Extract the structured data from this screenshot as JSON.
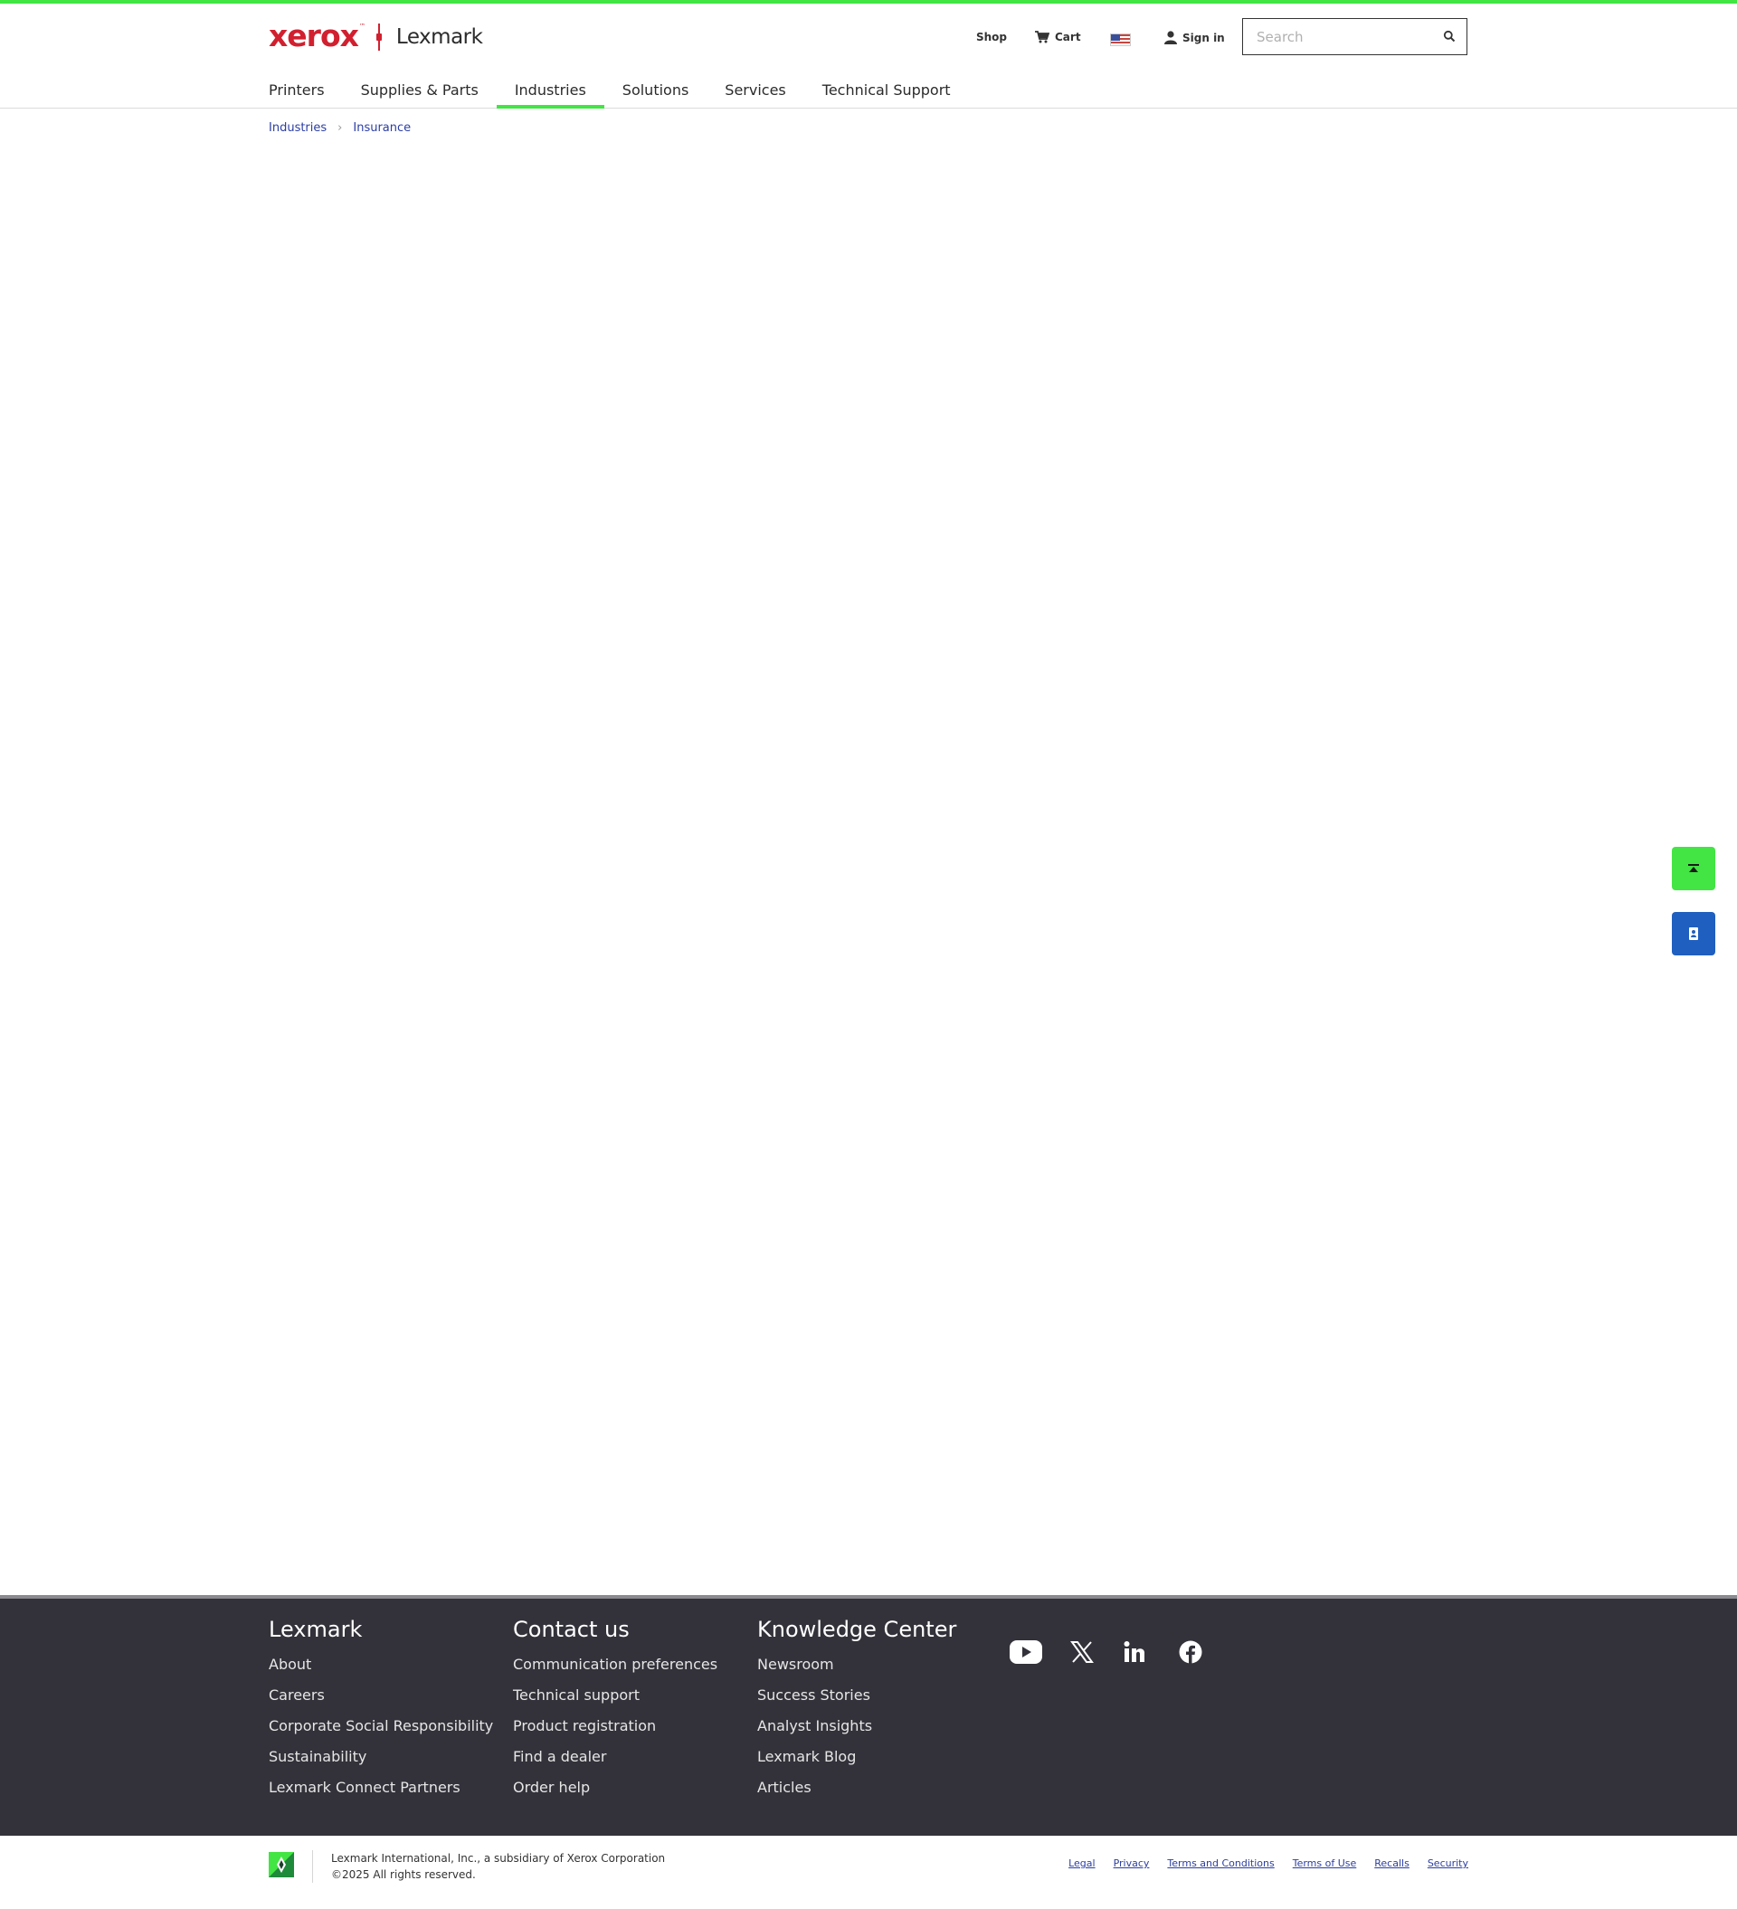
{
  "brand": {
    "primary_logo": "xerox",
    "secondary_logo": "Lexmark",
    "accent_green": "#42e543",
    "xerox_red": "#d1202f",
    "contact_blue": "#1f5fbf"
  },
  "utility": {
    "shop": "Shop",
    "cart": "Cart",
    "country_flag_icon": "us-flag-icon",
    "sign_in": "Sign in"
  },
  "search": {
    "placeholder": "Search",
    "value": ""
  },
  "nav": {
    "items": [
      "Printers",
      "Supplies & Parts",
      "Industries",
      "Solutions",
      "Services",
      "Technical Support"
    ],
    "active": "Industries"
  },
  "breadcrumb": [
    "Industries",
    "Insurance"
  ],
  "side_buttons": {
    "back_to_top_icon": "back-to-top-icon",
    "contact_icon": "contact-card-icon"
  },
  "footer": {
    "columns": [
      {
        "heading": "Lexmark",
        "links": [
          "About",
          "Careers",
          "Corporate Social Responsibility",
          "Sustainability",
          "Lexmark Connect Partners"
        ]
      },
      {
        "heading": "Contact us",
        "links": [
          "Communication preferences",
          "Technical support",
          "Product registration",
          "Find a dealer",
          "Order help"
        ]
      },
      {
        "heading": "Knowledge Center",
        "links": [
          "Newsroom",
          "Success Stories",
          "Analyst Insights",
          "Lexmark Blog",
          "Articles"
        ]
      }
    ],
    "social": [
      "youtube-icon",
      "x-icon",
      "linkedin-icon",
      "facebook-icon"
    ],
    "bg_color": "#33323a"
  },
  "bottom": {
    "company_line": "Lexmark International, Inc., a subsidiary of Xerox Corporation",
    "copyright": "©2025 All rights reserved.",
    "legal_links": [
      "Legal",
      "Privacy",
      "Terms and Conditions",
      "Terms of Use",
      "Recalls",
      "Security"
    ]
  }
}
